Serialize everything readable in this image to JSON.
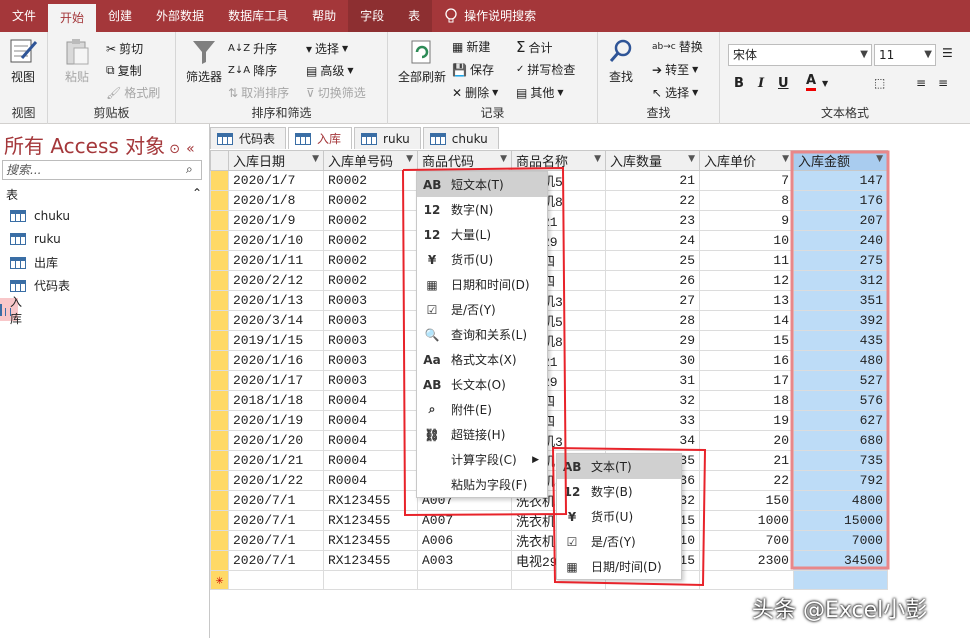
{
  "tabs": [
    {
      "label": "文件"
    },
    {
      "label": "开始"
    },
    {
      "label": "创建"
    },
    {
      "label": "外部数据"
    },
    {
      "label": "数据库工具"
    },
    {
      "label": "帮助"
    },
    {
      "label": "字段"
    },
    {
      "label": "表"
    }
  ],
  "tell_me": "操作说明搜索",
  "ribbon": {
    "view": {
      "btn": "视图",
      "label": "视图"
    },
    "clipboard": {
      "paste": "粘贴",
      "cut": "剪切",
      "copy": "复制",
      "painter": "格式刷",
      "label": "剪贴板"
    },
    "sort": {
      "filter": "筛选器",
      "asc": "升序",
      "desc": "降序",
      "clear": "取消排序",
      "select": "选择",
      "advanced": "高级",
      "toggle": "切换筛选",
      "label": "排序和筛选"
    },
    "records": {
      "refresh": "全部刷新",
      "new": "新建",
      "save": "保存",
      "delete": "删除",
      "totals": "合计",
      "spelling": "拼写检查",
      "more": "其他",
      "label": "记录"
    },
    "find": {
      "find": "查找",
      "replace": "替换",
      "goto": "转至",
      "select": "选择",
      "label": "查找"
    },
    "text": {
      "font": "宋体",
      "size": "11",
      "label": "文本格式",
      "bold": "B",
      "italic": "I",
      "underline": "U",
      "fontcolor": "A"
    }
  },
  "nav": {
    "title": "所有 Access 对象",
    "search_placeholder": "搜索...",
    "section": "表",
    "items": [
      {
        "label": "chuku"
      },
      {
        "label": "ruku"
      },
      {
        "label": "出库"
      },
      {
        "label": "代码表"
      },
      {
        "label": "入库"
      }
    ]
  },
  "doc_tabs": [
    {
      "label": "代码表"
    },
    {
      "label": "入库"
    },
    {
      "label": "ruku"
    },
    {
      "label": "chuku"
    }
  ],
  "table": {
    "columns": [
      "入库日期",
      "入库单号码",
      "商品代码",
      "商品名称",
      "入库数量",
      "入库单价",
      "入库金额"
    ],
    "rows": [
      [
        "2020/1/7",
        "R0002",
        "",
        "洗衣机5",
        "21",
        "7",
        "147"
      ],
      [
        "2020/1/8",
        "R0002",
        "",
        "洗衣机8",
        "22",
        "8",
        "176"
      ],
      [
        "2020/1/9",
        "R0002",
        "",
        "电视21",
        "23",
        "9",
        "207"
      ],
      [
        "2020/1/10",
        "R0002",
        "",
        "电视29",
        "24",
        "10",
        "240"
      ],
      [
        "2020/1/11",
        "R0002",
        "",
        "冰箱四",
        "25",
        "11",
        "275"
      ],
      [
        "2020/2/12",
        "R0002",
        "",
        "冰箱四",
        "26",
        "12",
        "312"
      ],
      [
        "2020/1/13",
        "R0003",
        "",
        "洗衣机3",
        "27",
        "13",
        "351"
      ],
      [
        "2020/3/14",
        "R0003",
        "",
        "洗衣机5",
        "28",
        "14",
        "392"
      ],
      [
        "2019/1/15",
        "R0003",
        "",
        "洗衣机8",
        "29",
        "15",
        "435"
      ],
      [
        "2020/1/16",
        "R0003",
        "",
        "电视21",
        "30",
        "16",
        "480"
      ],
      [
        "2020/1/17",
        "R0003",
        "",
        "电视29",
        "31",
        "17",
        "527"
      ],
      [
        "2018/1/18",
        "R0004",
        "",
        "冰箱四",
        "32",
        "18",
        "576"
      ],
      [
        "2020/1/19",
        "R0004",
        "",
        "冰箱四",
        "33",
        "19",
        "627"
      ],
      [
        "2020/1/20",
        "R0004",
        "",
        "洗衣机3",
        "34",
        "20",
        "680"
      ],
      [
        "2020/1/21",
        "R0004",
        "",
        "洗衣机5",
        "35",
        "21",
        "735"
      ],
      [
        "2020/1/22",
        "R0004",
        "",
        "洗衣机8",
        "36",
        "22",
        "792"
      ],
      [
        "2020/7/1",
        "RX123455",
        "A007",
        "洗衣机",
        "32",
        "150",
        "4800"
      ],
      [
        "2020/7/1",
        "RX123455",
        "A007",
        "洗衣机",
        "15",
        "1000",
        "15000"
      ],
      [
        "2020/7/1",
        "RX123455",
        "A006",
        "洗衣机",
        "10",
        "700",
        "7000"
      ],
      [
        "2020/7/1",
        "RX123455",
        "A003",
        "电视29",
        "15",
        "2300",
        "34500"
      ]
    ]
  },
  "menu1": [
    {
      "icon": "AB",
      "label": "短文本(T)"
    },
    {
      "icon": "12",
      "label": "数字(N)"
    },
    {
      "icon": "12",
      "label": "大量(L)"
    },
    {
      "icon": "¥",
      "label": "货币(U)"
    },
    {
      "icon": "▦",
      "label": "日期和时间(D)"
    },
    {
      "icon": "☑",
      "label": "是/否(Y)"
    },
    {
      "icon": "🔍",
      "label": "查询和关系(L)"
    },
    {
      "icon": "Aa",
      "label": "格式文本(X)"
    },
    {
      "icon": "AB",
      "label": "长文本(O)"
    },
    {
      "icon": "⌕",
      "label": "附件(E)"
    },
    {
      "icon": "⛓",
      "label": "超链接(H)"
    },
    {
      "icon": "",
      "label": "计算字段(C)"
    },
    {
      "icon": "",
      "label": "粘贴为字段(F)"
    }
  ],
  "menu2": [
    {
      "icon": "AB",
      "label": "文本(T)"
    },
    {
      "icon": "12",
      "label": "数字(B)"
    },
    {
      "icon": "¥",
      "label": "货币(U)"
    },
    {
      "icon": "☑",
      "label": "是/否(Y)"
    },
    {
      "icon": "▦",
      "label": "日期/时间(D)"
    }
  ],
  "watermark": "头条 @Excel小彭",
  "colors": {
    "brand": "#a4373a",
    "selected_col": "#bddcf7",
    "annotation": "#e8232a"
  }
}
